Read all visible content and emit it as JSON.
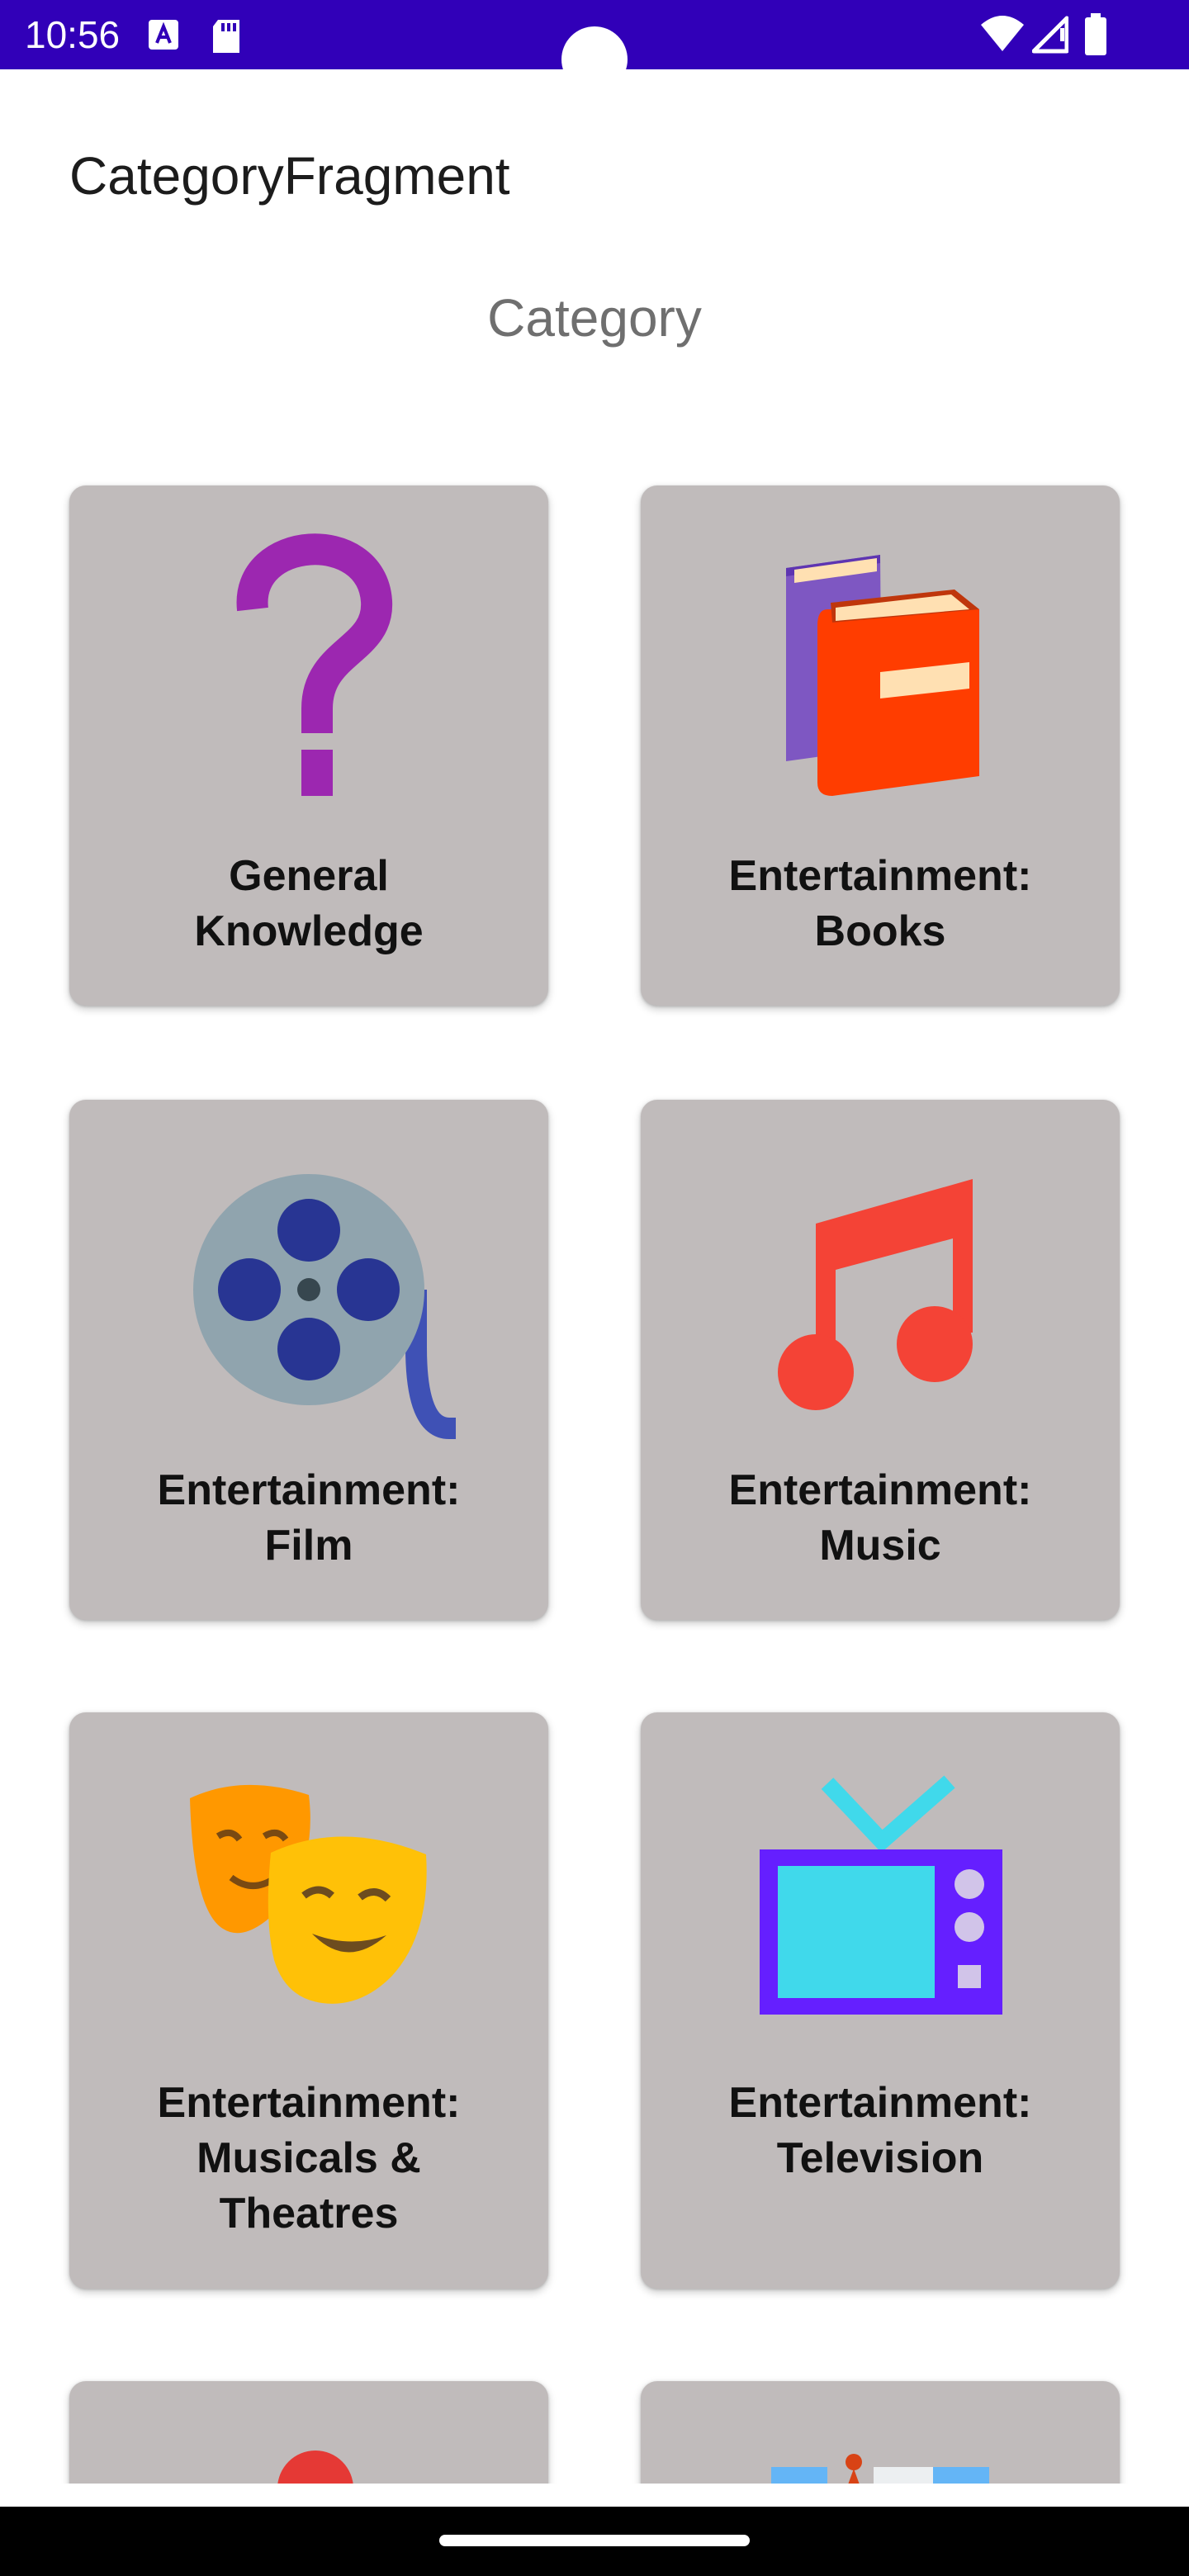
{
  "status_bar": {
    "time": "10:56",
    "left_icons": [
      "a-notification-icon",
      "sd-card-icon"
    ],
    "right_icons": [
      "wifi-icon",
      "cell-signal-icon",
      "battery-icon"
    ]
  },
  "app_bar": {
    "title": "CategoryFragment"
  },
  "header": {
    "title": "Category"
  },
  "categories": [
    {
      "line1": "General",
      "line2": "Knowledge",
      "line3": "",
      "icon": "question-mark-icon"
    },
    {
      "line1": "Entertainment:",
      "line2": "Books",
      "line3": "",
      "icon": "books-icon"
    },
    {
      "line1": "Entertainment:",
      "line2": "Film",
      "line3": "",
      "icon": "film-reel-icon"
    },
    {
      "line1": "Entertainment:",
      "line2": "Music",
      "line3": "",
      "icon": "music-note-icon"
    },
    {
      "line1": "Entertainment:",
      "line2": "Musicals &",
      "line3": "Theatres",
      "icon": "theatre-masks-icon"
    },
    {
      "line1": "Entertainment:",
      "line2": "Television",
      "line3": "",
      "icon": "television-icon"
    }
  ],
  "colors": {
    "status_bar": "#3100b8",
    "card_bg": "#c0bbbb",
    "question_mark": "#9c27b0",
    "book_front": "#ff3d00",
    "book_back": "#7e57c2",
    "film_reel": "#90a4ae",
    "film_holes": "#283593",
    "music_note": "#f44336",
    "mask_back": "#ff9800",
    "mask_front": "#ffc107",
    "tv_body": "#651fff",
    "tv_screen": "#40d9eb"
  }
}
